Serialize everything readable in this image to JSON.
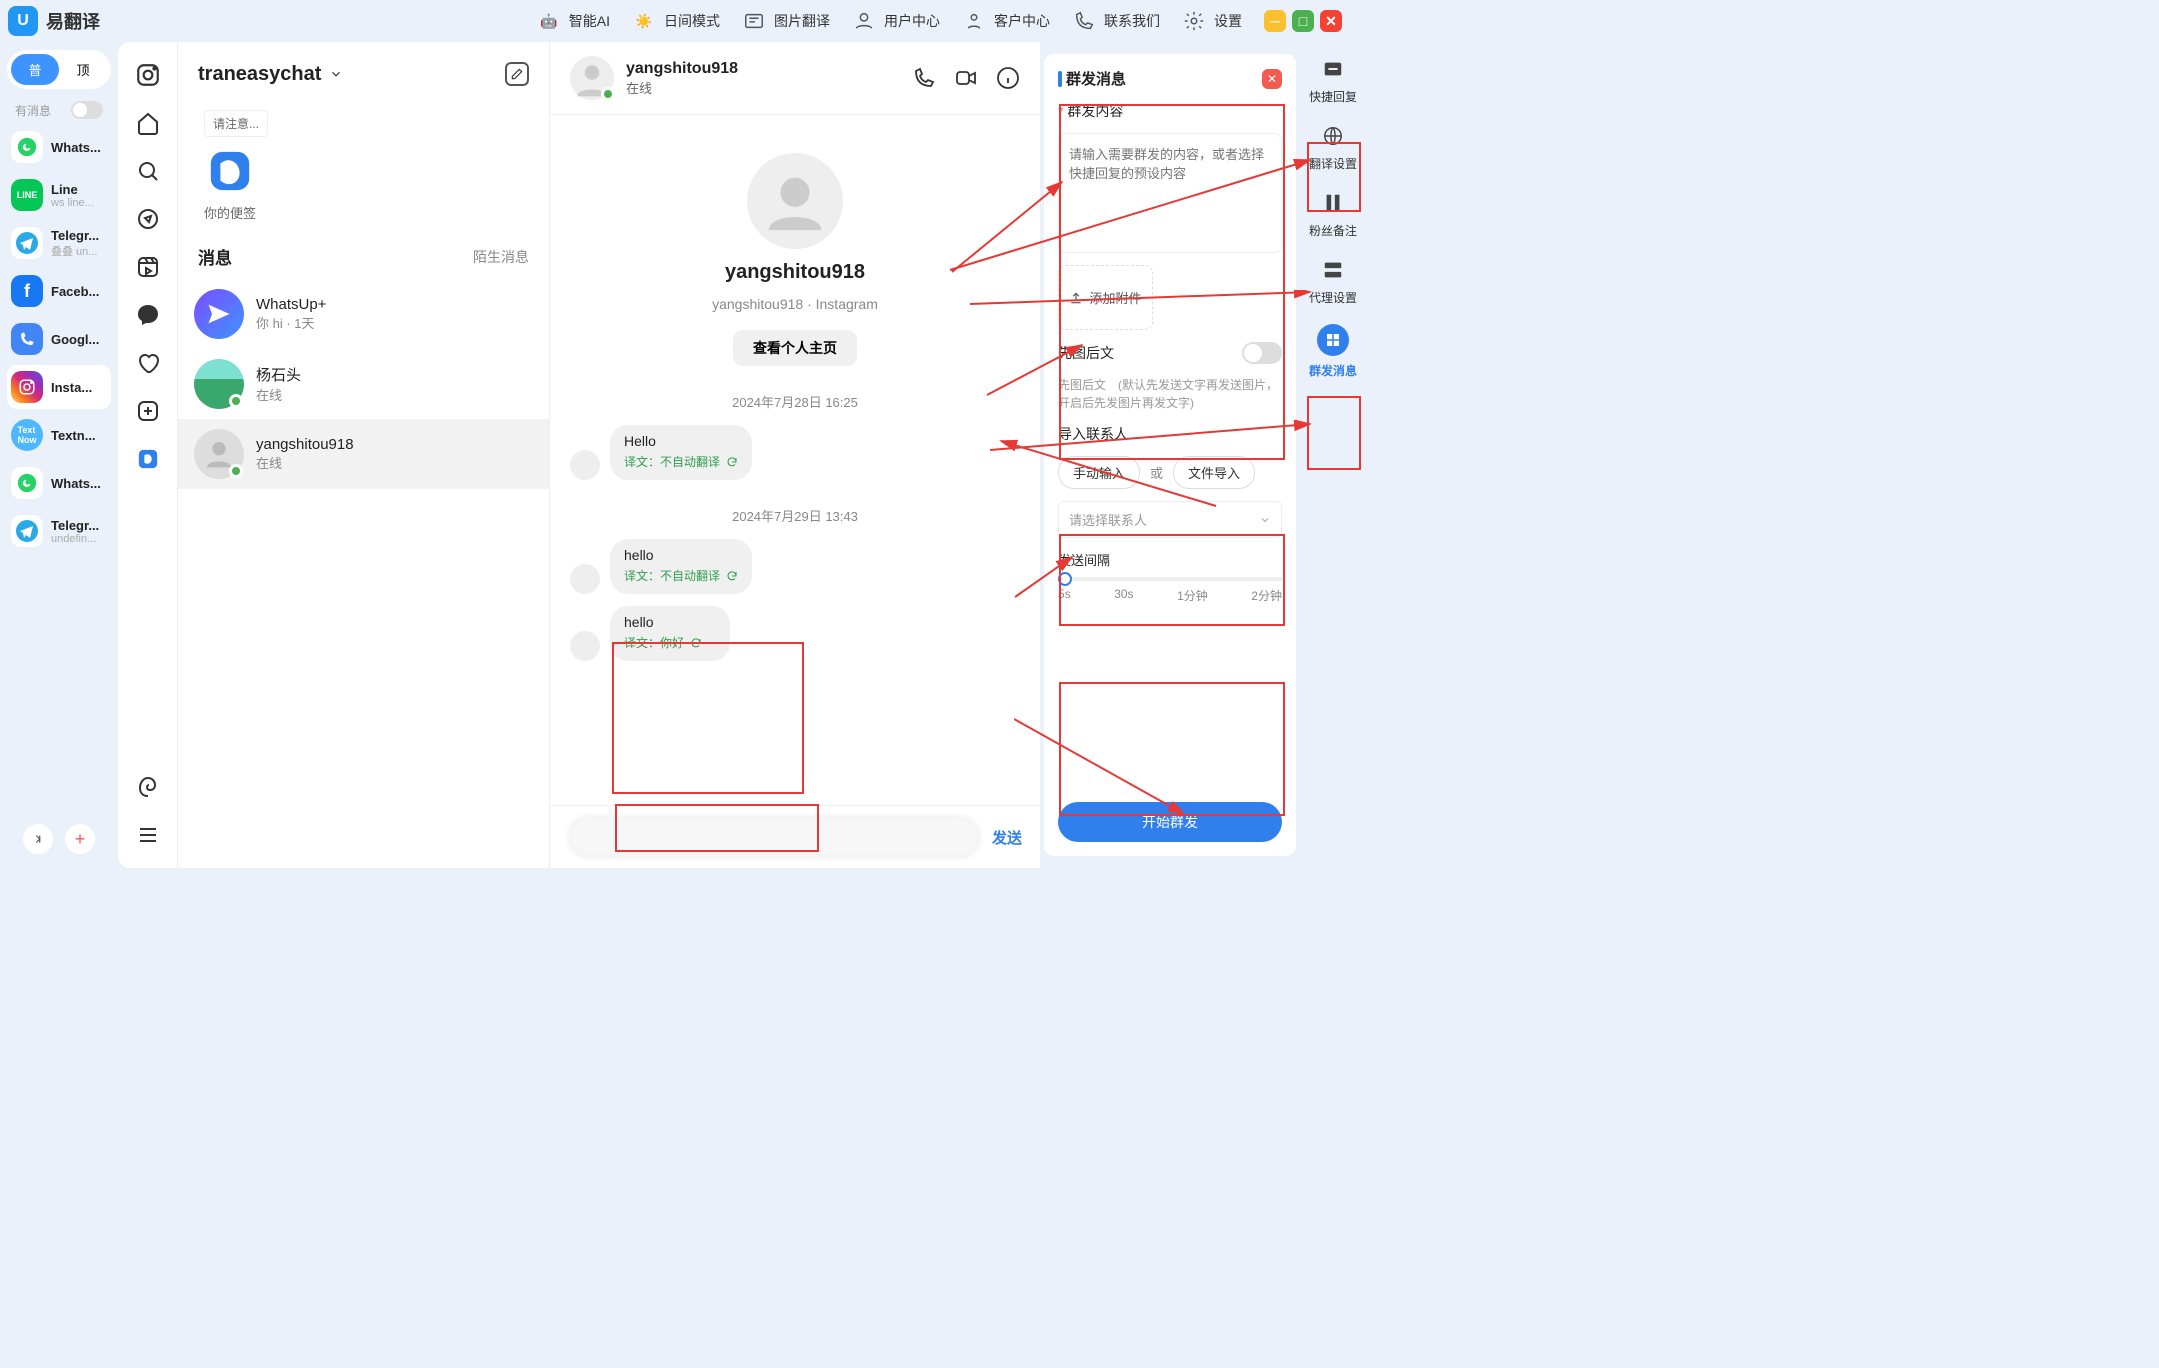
{
  "app": {
    "name": "易翻译",
    "logo_letter": "U"
  },
  "topbar": {
    "items": [
      {
        "label": "智能AI"
      },
      {
        "label": "日间模式"
      },
      {
        "label": "图片翻译"
      },
      {
        "label": "用户中心"
      },
      {
        "label": "客户中心"
      },
      {
        "label": "联系我们"
      },
      {
        "label": "设置"
      }
    ]
  },
  "accounts": {
    "tab_primary": "普",
    "tab_top": "顶",
    "has_msg_label": "有消息",
    "items": [
      {
        "name": "Whats...",
        "sub": ""
      },
      {
        "name": "Line",
        "sub": "ws line..."
      },
      {
        "name": "Telegr...",
        "sub": "叠叠 un..."
      },
      {
        "name": "Faceb...",
        "sub": ""
      },
      {
        "name": "Googl...",
        "sub": ""
      },
      {
        "name": "Insta...",
        "sub": ""
      },
      {
        "name": "Textn...",
        "sub": ""
      },
      {
        "name": "Whats...",
        "sub": ""
      },
      {
        "name": "Telegr...",
        "sub": "undefin..."
      }
    ]
  },
  "convlist": {
    "title": "traneasychat",
    "notice_label": "请注意...",
    "note_caption": "你的便签",
    "section_title": "消息",
    "section_link": "陌生消息",
    "conversations": [
      {
        "name": "WhatsUp+",
        "sub": "你 hi · 1天"
      },
      {
        "name": "杨石头",
        "sub": "在线"
      },
      {
        "name": "yangshitou918",
        "sub": "在线"
      }
    ]
  },
  "chat": {
    "header": {
      "name": "yangshitou918",
      "status": "在线"
    },
    "profile": {
      "name": "yangshitou918",
      "sub": "yangshitou918 · Instagram",
      "view_btn": "查看个人主页"
    },
    "dates": {
      "d1": "2024年7月28日 16:25",
      "d2": "2024年7月29日 13:43"
    },
    "messages": {
      "m1": {
        "text": "Hello",
        "trans": "译文：不自动翻译"
      },
      "m2": {
        "text": "hello",
        "trans": "译文：不自动翻译"
      },
      "m3": {
        "text": "hello",
        "trans": "译文：你好"
      }
    },
    "send_label": "发送"
  },
  "panel": {
    "title": "群发消息",
    "content_label": "群发内容",
    "content_placeholder": "请输入需要群发的内容，或者选择快捷回复的预设内容",
    "attach_label": "添加附件",
    "toggle_label": "先图后文",
    "toggle_help_title": "先图后文",
    "toggle_help": "(默认先发送文字再发送图片，开启后先发图片再发文字)",
    "import_label": "导入联系人",
    "chip_manual": "手动输入",
    "chip_or": "或",
    "chip_file": "文件导入",
    "select_placeholder": "请选择联系人",
    "interval_label": "发送间隔",
    "interval_options": [
      "5s",
      "30s",
      "1分钟",
      "2分钟"
    ],
    "start_btn": "开始群发"
  },
  "right_rail": {
    "items": [
      {
        "label": "快捷回复"
      },
      {
        "label": "翻译设置"
      },
      {
        "label": "粉丝备注"
      },
      {
        "label": "代理设置"
      },
      {
        "label": "群发消息"
      }
    ]
  }
}
